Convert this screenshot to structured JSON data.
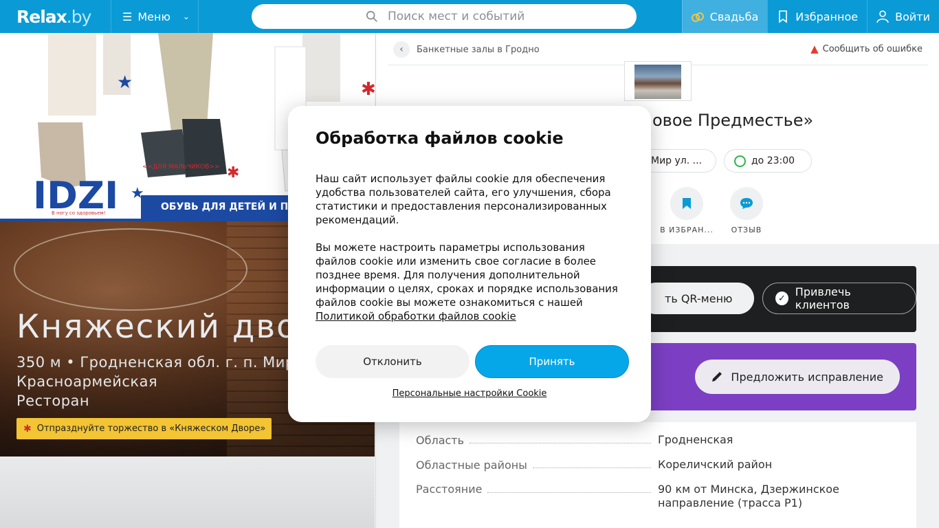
{
  "header": {
    "logo": "Relax",
    "logo_suffix": ".by",
    "menu_label": "Меню",
    "search_placeholder": "Поиск мест и событий",
    "wedding_label": "Свадьба",
    "favorites_label": "Избранное",
    "login_label": "Войти"
  },
  "banner": {
    "brand": "IDZI",
    "brand_tagline": "В ногу со здоровьем!",
    "caption_boys": "<<ДЛЯ МАЛЬЧИКОВ>>",
    "slogan": "ОБУВЬ ДЛЯ ДЕТЕЙ И П"
  },
  "hero": {
    "title": "Княжеский дво",
    "address_line1": "350 м • Гродненская обл. г. п. Мир",
    "address_line2": "Красноармейская",
    "category": "Ресторан",
    "promo": "Отпразднуйте торжество в «Княжеском Дворе»"
  },
  "place": {
    "breadcrumb": "Банкетные залы в Гродно",
    "report_label": "Сообщить об ошибке",
    "title_visible": "овое Предместье»",
    "address_chip": "Мир ул. ...",
    "hours_chip": "до 23:00",
    "actions": [
      {
        "label": "В ИЗБРАН..."
      },
      {
        "label": "ОТЗЫВ"
      }
    ],
    "qr_label": "ть QR-меню",
    "attract_label": "Привлечь клиентов",
    "suggest_label": "Предложить исправление"
  },
  "info": [
    {
      "key": "Область",
      "value": "Гродненская"
    },
    {
      "key": "Областные районы",
      "value": "Кореличский район"
    },
    {
      "key": "Расстояние",
      "value": "90 км от Минска, Дзержинское направление (трасса Р1)"
    }
  ],
  "cookie": {
    "title": "Обработка файлов cookie",
    "paragraph1": "Наш сайт использует файлы cookie для обеспечения удобства пользователей сайта, его улучшения, сбора статистики и предоставления персонализированных рекомендаций.",
    "paragraph2": "Вы можете настроить параметры использования файлов cookie или изменить свое согласие в более позднее время. Для получения дополнительной информации о целях, сроках и порядке использования файлов cookie вы можете ознакомиться с нашей",
    "policy_link": "Политикой обработки файлов cookie",
    "decline": "Отклонить",
    "accept": "Принять",
    "settings_link": "Персональные настройки Cookie"
  },
  "colors": {
    "header_bg": "#0a9bd6",
    "accept_bg": "#06a7e9",
    "promo_bg": "#f3c434",
    "purple_card": "#7c3fc4",
    "dark_card": "#1e1f20"
  }
}
